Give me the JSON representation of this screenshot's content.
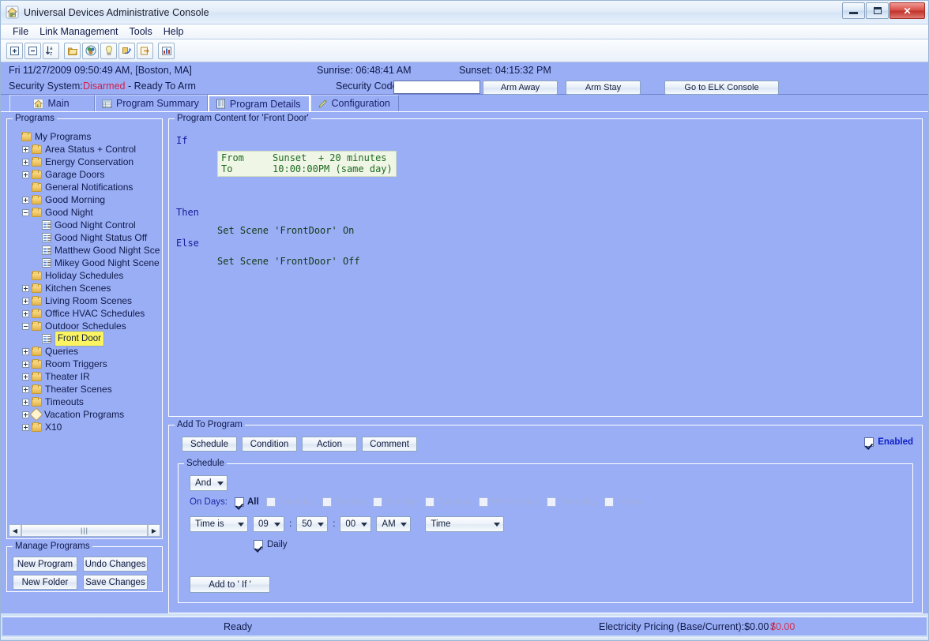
{
  "window": {
    "title": "Universal Devices Administrative Console",
    "app_icon": "house-icon",
    "minimize_label": "",
    "maximize_label": "",
    "close_label": "✕"
  },
  "menubar": {
    "items": [
      {
        "label": "File",
        "name": "menu-file"
      },
      {
        "label": "Link Management",
        "name": "menu-link-management"
      },
      {
        "label": "Tools",
        "name": "menu-tools"
      },
      {
        "label": "Help",
        "name": "menu-help"
      }
    ]
  },
  "toolbar": {
    "buttons": [
      {
        "name": "expand-all-icon",
        "glyph": "+"
      },
      {
        "name": "collapse-all-icon",
        "glyph": "−"
      },
      {
        "name": "sort-az-icon",
        "glyph": "a↓z"
      },
      {
        "name": "folder-icon",
        "glyph": ""
      },
      {
        "name": "scenes-icon",
        "glyph": ""
      },
      {
        "name": "lightbulb-icon",
        "glyph": ""
      },
      {
        "name": "refresh-links-icon",
        "glyph": ""
      },
      {
        "name": "export-icon",
        "glyph": ""
      },
      {
        "name": "chart-icon",
        "glyph": ""
      }
    ]
  },
  "infostrip": {
    "datetime": "Fri 11/27/2009 09:50:49 AM,  [Boston, MA]",
    "sunrise": "Sunrise: 06:48:41 AM",
    "sunset": "Sunset: 04:15:32 PM",
    "security_system_label": "Security System:",
    "security_status": "Disarmed",
    "security_status_suffix": "- Ready To Arm",
    "security_code_label": "Security Code",
    "security_code_value": "",
    "arm_away_label": "Arm Away",
    "arm_stay_label": "Arm Stay",
    "elk_console_label": "Go to ELK Console"
  },
  "tabs": [
    {
      "label": "Main",
      "icon": "house-icon",
      "active": false,
      "name": "tab-main"
    },
    {
      "label": "Program Summary",
      "icon": "table-icon",
      "active": false,
      "name": "tab-program-summary"
    },
    {
      "label": "Program Details",
      "icon": "document-icon",
      "active": true,
      "name": "tab-program-details"
    },
    {
      "label": "Configuration",
      "icon": "pencil-icon",
      "active": false,
      "name": "tab-configuration"
    }
  ],
  "left_panel": {
    "programs_title": "Programs",
    "tree": [
      {
        "label": "My Programs",
        "depth": 0,
        "icon": "folder",
        "expander": "none",
        "selected": false
      },
      {
        "label": "Area Status + Control",
        "depth": 1,
        "icon": "folder",
        "expander": "plus",
        "selected": false
      },
      {
        "label": "Energy Conservation",
        "depth": 1,
        "icon": "folder",
        "expander": "plus",
        "selected": false
      },
      {
        "label": "Garage Doors",
        "depth": 1,
        "icon": "folder",
        "expander": "plus",
        "selected": false
      },
      {
        "label": "General Notifications",
        "depth": 1,
        "icon": "folder",
        "expander": "none",
        "selected": false
      },
      {
        "label": "Good Morning",
        "depth": 1,
        "icon": "folder",
        "expander": "plus",
        "selected": false
      },
      {
        "label": "Good Night",
        "depth": 1,
        "icon": "folder",
        "expander": "minus",
        "selected": false
      },
      {
        "label": "Good Night Control",
        "depth": 2,
        "icon": "doc",
        "expander": "none",
        "selected": false
      },
      {
        "label": "Good Night Status Off",
        "depth": 2,
        "icon": "doc",
        "expander": "none",
        "selected": false
      },
      {
        "label": "Matthew Good Night Scene",
        "depth": 2,
        "icon": "doc",
        "expander": "none",
        "selected": false
      },
      {
        "label": "Mikey Good Night Scene",
        "depth": 2,
        "icon": "doc",
        "expander": "none",
        "selected": false
      },
      {
        "label": "Holiday Schedules",
        "depth": 1,
        "icon": "folder",
        "expander": "none",
        "selected": false
      },
      {
        "label": "Kitchen Scenes",
        "depth": 1,
        "icon": "folder",
        "expander": "plus",
        "selected": false
      },
      {
        "label": "Living Room Scenes",
        "depth": 1,
        "icon": "folder",
        "expander": "plus",
        "selected": false
      },
      {
        "label": "Office HVAC Schedules",
        "depth": 1,
        "icon": "folder",
        "expander": "plus",
        "selected": false
      },
      {
        "label": "Outdoor Schedules",
        "depth": 1,
        "icon": "folder",
        "expander": "minus",
        "selected": false
      },
      {
        "label": "Front Door",
        "depth": 2,
        "icon": "doc",
        "expander": "none",
        "selected": true
      },
      {
        "label": "Queries",
        "depth": 1,
        "icon": "folder",
        "expander": "plus",
        "selected": false
      },
      {
        "label": "Room Triggers",
        "depth": 1,
        "icon": "folder",
        "expander": "plus",
        "selected": false
      },
      {
        "label": "Theater IR",
        "depth": 1,
        "icon": "folder",
        "expander": "plus",
        "selected": false
      },
      {
        "label": "Theater Scenes",
        "depth": 1,
        "icon": "folder",
        "expander": "plus",
        "selected": false
      },
      {
        "label": "Timeouts",
        "depth": 1,
        "icon": "folder",
        "expander": "plus",
        "selected": false
      },
      {
        "label": "Vacation Programs",
        "depth": 1,
        "icon": "gear",
        "expander": "plus",
        "selected": false
      },
      {
        "label": "X10",
        "depth": 1,
        "icon": "folder",
        "expander": "plus",
        "selected": false
      }
    ],
    "manage_title": "Manage Programs",
    "manage_buttons": [
      {
        "label": "New Program",
        "name": "new-program-button"
      },
      {
        "label": "Undo Changes",
        "name": "undo-changes-button"
      },
      {
        "label": "New Folder",
        "name": "new-folder-button"
      },
      {
        "label": "Save Changes",
        "name": "save-changes-button"
      }
    ]
  },
  "program_content": {
    "title": "Program Content for 'Front Door'",
    "if_label": "If",
    "then_label": "Then",
    "else_label": "Else",
    "condition_from": "From     Sunset  + 20 minutes",
    "condition_to": "To       10:00:00PM (same day)",
    "then_statement": "Set Scene 'FrontDoor' On",
    "else_statement": "Set Scene 'FrontDoor' Off"
  },
  "add_to_program": {
    "title": "Add To Program",
    "buttons": [
      {
        "label": "Schedule",
        "name": "schedule-button"
      },
      {
        "label": "Condition",
        "name": "condition-button"
      },
      {
        "label": "Action",
        "name": "action-button"
      },
      {
        "label": "Comment",
        "name": "comment-button"
      }
    ],
    "enabled_label": "Enabled",
    "enabled_checked": true,
    "schedule": {
      "title": "Schedule",
      "logic_operator": "And",
      "on_days_label": "On Days:",
      "days": [
        {
          "label": "All",
          "checked": true,
          "enabled": true
        },
        {
          "label": "Saturday",
          "checked": false,
          "enabled": false
        },
        {
          "label": "Sunday",
          "checked": false,
          "enabled": false
        },
        {
          "label": "Monday",
          "checked": false,
          "enabled": false
        },
        {
          "label": "Tuesday",
          "checked": false,
          "enabled": false
        },
        {
          "label": "Wednesday",
          "checked": false,
          "enabled": false
        },
        {
          "label": "Thursday",
          "checked": false,
          "enabled": false
        },
        {
          "label": "Friday",
          "checked": false,
          "enabled": false
        }
      ],
      "time_mode": "Time is",
      "hour": "09",
      "minute": "50",
      "second": "00",
      "meridiem": "AM",
      "time_type": "Time",
      "colon": ":",
      "daily_label": "Daily",
      "daily_checked": true,
      "add_to_if_label": "Add to ' If '"
    }
  },
  "statusbar": {
    "ready_text": "Ready",
    "pricing_label": "Electricity Pricing (Base/Current):$0.00 /",
    "pricing_current": "$0.00"
  },
  "colors": {
    "window_bg": "#9aaef5",
    "accent_blue": "#101a4a",
    "alarm_red": "#cf1f4a",
    "selection_yellow": "#fbf360",
    "code_green": "#1d6b21",
    "keyword_blue": "#17199c"
  }
}
